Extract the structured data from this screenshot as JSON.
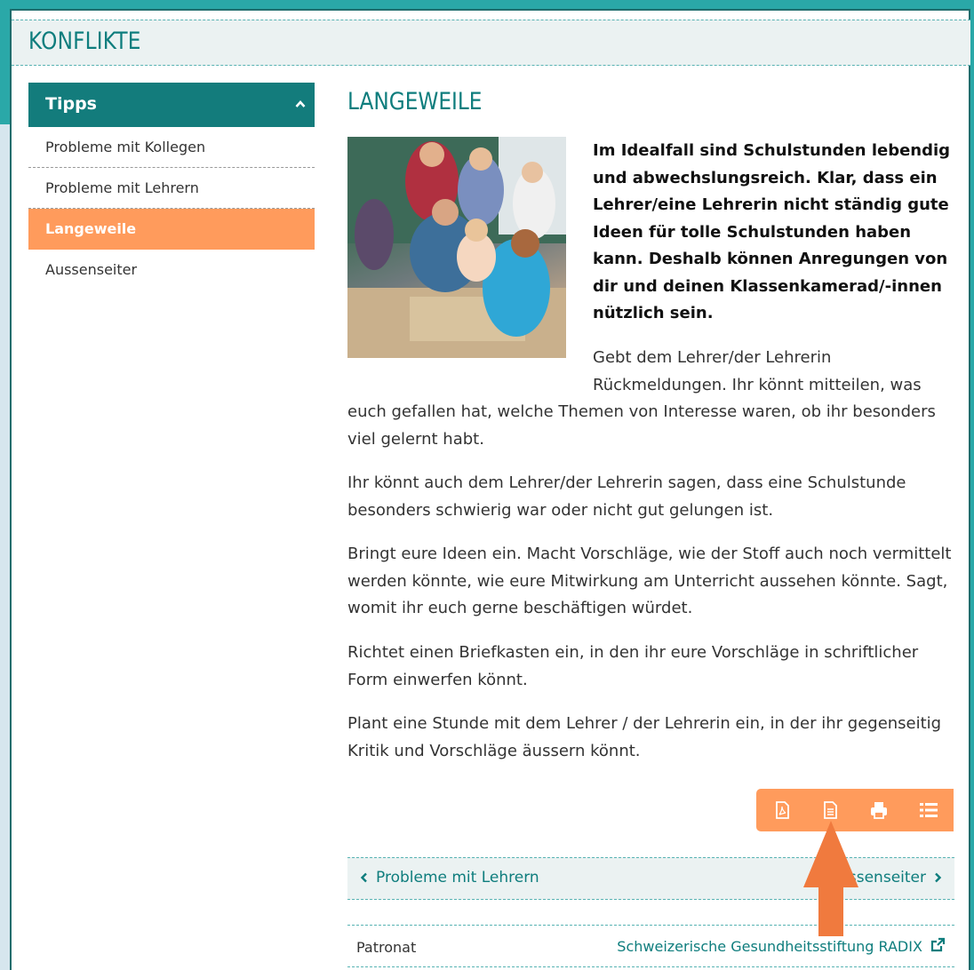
{
  "header": {
    "title": "KONFLIKTE"
  },
  "sidebar": {
    "heading": "Tipps",
    "items": [
      {
        "label": "Probleme mit Kollegen"
      },
      {
        "label": "Probleme mit Lehrern"
      },
      {
        "label": "Langeweile",
        "active": true
      },
      {
        "label": "Aussenseiter"
      }
    ]
  },
  "main": {
    "title": "LANGEWEILE",
    "lead": "Im Idealfall sind Schulstunden lebendig und abwechslungsreich. Klar, dass ein Lehrer/eine Lehrerin nicht ständig gute Ideen für tolle Schulstunden haben kann. Deshalb können Anregungen von dir und deinen Klassenkamerad/-innen nützlich sein.",
    "p0_line1": "Gebt dem Lehrer/der Lehrerin",
    "p0_line2": "Rückmeldungen. Ihr könnt mitteilen, was",
    "p0_rest": "euch gefallen hat, welche Themen von Interesse waren, ob ihr besonders viel gelernt habt.",
    "paragraphs": [
      "Ihr könnt auch dem Lehrer/der Lehrerin sagen, dass eine Schulstunde besonders schwierig war oder nicht gut gelungen ist.",
      "Bringt eure Ideen ein. Macht Vorschläge, wie der Stoff auch noch vermittelt werden könnte, wie eure Mitwirkung am Unterricht aussehen könnte. Sagt, womit ihr euch gerne beschäftigen würdet.",
      "Richtet einen Briefkasten ein, in den ihr eure Vorschläge in schriftlicher Form einwerfen könnt.",
      "Plant eine Stunde mit dem Lehrer / der Lehrerin ein, in der ihr gegenseitig Kritik und Vorschläge äussern könnt."
    ]
  },
  "toolbar": {
    "icons": [
      "pdf-icon",
      "document-icon",
      "print-icon",
      "list-icon"
    ]
  },
  "pager": {
    "prev_label": "Probleme mit Lehrern",
    "next_label": "Aussenseiter"
  },
  "footer": {
    "patronat_label": "Patronat",
    "patronat_link": "Schweizerische Gesundheitsstiftung RADIX"
  },
  "colors": {
    "teal": "#0e7d7d",
    "sidebar_header": "#137c7c",
    "orange": "#ff9b5c",
    "arrow": "#f07a3e",
    "header_bg": "#ebf2f2"
  }
}
